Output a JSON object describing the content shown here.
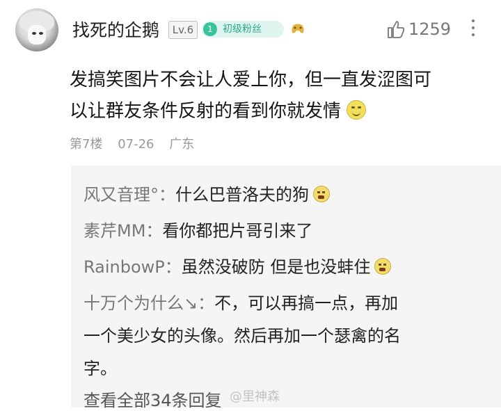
{
  "header": {
    "username": "找死的企鹅",
    "level": "Lv.6",
    "fan_badge_number": "1",
    "fan_badge_label": "初级粉丝",
    "like_count": "1259",
    "icons": [
      "avatar",
      "controller-icon",
      "like-icon",
      "more-icon"
    ]
  },
  "comment": {
    "line1": "发搞笑图片不会让人爱上你，但一直发涩图可",
    "line2": "以让群友条件反射的看到你就发情",
    "floor": "第7楼",
    "date": "07-26",
    "location": "广东"
  },
  "replies": [
    {
      "author": "风又音理°：",
      "text": "什么巴普洛夫的狗"
    },
    {
      "author": "素芹MM：",
      "text": "看你都把片哥引来了"
    },
    {
      "author": "RainbowP：",
      "text": "虽然没破防 但是也没蚌住"
    },
    {
      "author": "十万个为什么↘：",
      "text": "不，可以再搞一点，再加"
    }
  ],
  "reply4_cont1": "一个美少女的头像。然后再加一个瑟禽的名",
  "reply4_cont2": "字。",
  "view_all": "查看全部34条回复",
  "watermark": "@里神森",
  "colors": {
    "badge_green": "#39c39d",
    "reply_bg": "#f5f5f5"
  }
}
